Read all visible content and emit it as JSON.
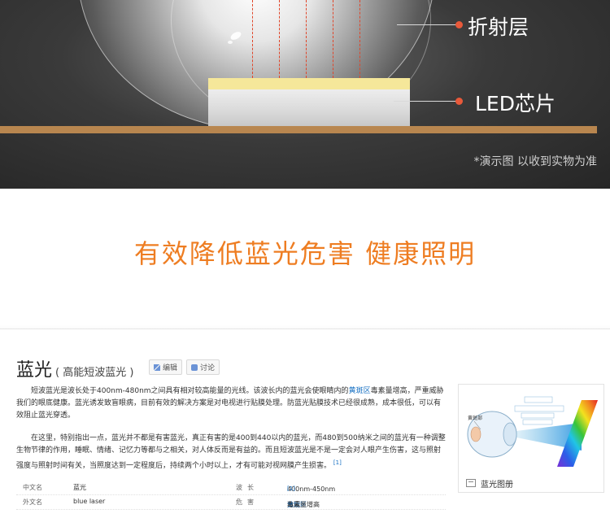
{
  "hero": {
    "label_refraction": "折射层",
    "label_chip": "LED芯片",
    "note": "*演示图 以收到实物为准"
  },
  "slogan": "有效降低蓝光危害 健康照明",
  "baike": {
    "title": "蓝光",
    "subtitle": "( 高能短波蓝光 )",
    "edit_label": "编辑",
    "discuss_label": "讨论",
    "para1": {
      "before_link": "短波蓝光是波长处于400nm-480nm之间具有相对较高能量的光线。该波长内的蓝光会使眼睛内的",
      "link": "黄斑区",
      "after_link": "毒素量增高，严重威胁我们的眼底健康。蓝光诱发致盲眼病，目前有效的解决方案是对电视进行贴膜处理。防蓝光贴膜技术已经很成熟，成本很低，可以有效阻止蓝光穿透。"
    },
    "para2": {
      "text": "在这里，特别指出一点，蓝光并不都是有害蓝光，真正有害的是400到440以内的蓝光，而480到500纳米之间的蓝光有一种调整生物节律的作用，睡眠、情绪、记忆力等都与之相关，对人体反而是有益的。而且短波蓝光是不是一定会对人眼产生伤害，这与照射强度与照射时间有关，当照度达到一定程度后，持续两个小时以上，才有可能对视网膜产生损害。",
      "ref": "[1]"
    },
    "info": {
      "cn_name_key": "中文名",
      "cn_name_val": "蓝光",
      "wavelength_key": "波长",
      "wavelength_val": "400nm-450nm",
      "wavelength_ref": "[1]",
      "en_name_key": "外文名",
      "en_name_val": "blue laser",
      "harm_key": "危害",
      "harm_before": "造成",
      "harm_link": "黄斑区",
      "harm_after": "毒素量增高"
    },
    "figure": {
      "caption": "蓝光图册",
      "label_macula": "黄斑部"
    }
  },
  "colors": {
    "accent_orange": "#ee7d22",
    "lead_dot": "#e8593a",
    "chip_top": "#f5e79a",
    "board": "#b8864f",
    "link": "#136ec2"
  }
}
